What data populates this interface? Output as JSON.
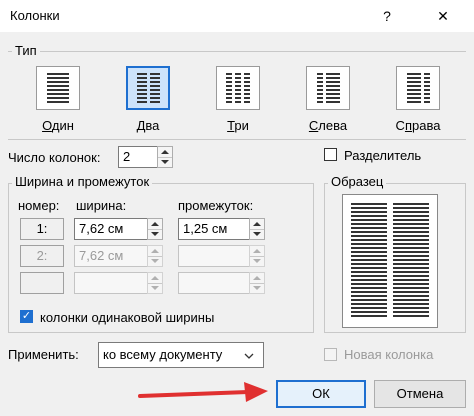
{
  "window": {
    "title": "Колонки",
    "help_label": "?",
    "close_label": "✕"
  },
  "type_group": {
    "label": "Тип",
    "presets": [
      {
        "label": "Один",
        "selected": false
      },
      {
        "label": "Два",
        "selected": true
      },
      {
        "label": "Три",
        "selected": false
      },
      {
        "label": "Слева",
        "selected": false
      },
      {
        "label": "Справа",
        "selected": false
      }
    ]
  },
  "num_columns": {
    "label": "Число колонок:",
    "value": "2"
  },
  "separator": {
    "label": "Разделитель",
    "checked": false
  },
  "width_spacing": {
    "label": "Ширина и промежуток",
    "col_number_header": "номер:",
    "width_header": "ширина:",
    "spacing_header": "промежуток:",
    "rows": [
      {
        "number": "1:",
        "width": "7,62 см",
        "spacing": "1,25 см",
        "enabled": true
      },
      {
        "number": "2:",
        "width": "7,62 см",
        "spacing": "",
        "enabled": false
      },
      {
        "number": "",
        "width": "",
        "spacing": "",
        "enabled": false
      }
    ],
    "equal_width": {
      "label": "колонки одинаковой ширины",
      "checked": true
    }
  },
  "preview": {
    "label": "Образец"
  },
  "apply": {
    "label": "Применить:",
    "value": "ко всему документу"
  },
  "new_column": {
    "label": "Новая колонка",
    "checked": false,
    "enabled": false
  },
  "buttons": {
    "ok_label": "ОК",
    "cancel_label": "Отмена"
  },
  "colors": {
    "accent": "#1e6fd0",
    "arrow": "#e03030"
  }
}
